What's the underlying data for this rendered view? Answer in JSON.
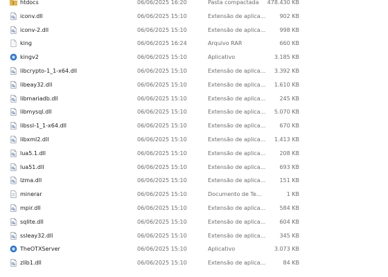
{
  "files": [
    {
      "name": "htdocs",
      "modified": "06/06/2025 16:20",
      "type": "Pasta compactada",
      "size": "478.430 KB",
      "icon": "zip-folder-icon"
    },
    {
      "name": "iconv.dll",
      "modified": "06/06/2025 15:10",
      "type": "Extensão de aplica...",
      "size": "902 KB",
      "icon": "dll-file-icon"
    },
    {
      "name": "iconv-2.dll",
      "modified": "06/06/2025 15:10",
      "type": "Extensão de aplica...",
      "size": "998 KB",
      "icon": "dll-file-icon"
    },
    {
      "name": "king",
      "modified": "06/06/2025 16:24",
      "type": "Arquivo RAR",
      "size": "660 KB",
      "icon": "generic-file-icon"
    },
    {
      "name": "kingv2",
      "modified": "06/06/2025 15:10",
      "type": "Aplicativo",
      "size": "3.185 KB",
      "icon": "app-icon"
    },
    {
      "name": "libcrypto-1_1-x64.dll",
      "modified": "06/06/2025 15:10",
      "type": "Extensão de aplica...",
      "size": "3.392 KB",
      "icon": "dll-file-icon"
    },
    {
      "name": "libeay32.dll",
      "modified": "06/06/2025 15:10",
      "type": "Extensão de aplica...",
      "size": "1.610 KB",
      "icon": "dll-file-icon"
    },
    {
      "name": "libmariadb.dll",
      "modified": "06/06/2025 15:10",
      "type": "Extensão de aplica...",
      "size": "245 KB",
      "icon": "dll-file-icon"
    },
    {
      "name": "libmysql.dll",
      "modified": "06/06/2025 15:10",
      "type": "Extensão de aplica...",
      "size": "5.070 KB",
      "icon": "dll-file-icon"
    },
    {
      "name": "libssl-1_1-x64.dll",
      "modified": "06/06/2025 15:10",
      "type": "Extensão de aplica...",
      "size": "670 KB",
      "icon": "dll-file-icon"
    },
    {
      "name": "libxml2.dll",
      "modified": "06/06/2025 15:10",
      "type": "Extensão de aplica...",
      "size": "1.413 KB",
      "icon": "dll-file-icon"
    },
    {
      "name": "lua5.1.dll",
      "modified": "06/06/2025 15:10",
      "type": "Extensão de aplica...",
      "size": "208 KB",
      "icon": "dll-file-icon"
    },
    {
      "name": "lua51.dll",
      "modified": "06/06/2025 15:10",
      "type": "Extensão de aplica...",
      "size": "693 KB",
      "icon": "dll-file-icon"
    },
    {
      "name": "lzma.dll",
      "modified": "06/06/2025 15:10",
      "type": "Extensão de aplica...",
      "size": "151 KB",
      "icon": "dll-file-icon"
    },
    {
      "name": "minerar",
      "modified": "06/06/2025 15:10",
      "type": "Documento de Te...",
      "size": "1 KB",
      "icon": "text-document-icon"
    },
    {
      "name": "mpir.dll",
      "modified": "06/06/2025 15:10",
      "type": "Extensão de aplica...",
      "size": "584 KB",
      "icon": "dll-file-icon"
    },
    {
      "name": "sqlite.dll",
      "modified": "06/06/2025 15:10",
      "type": "Extensão de aplica...",
      "size": "604 KB",
      "icon": "dll-file-icon"
    },
    {
      "name": "ssleay32.dll",
      "modified": "06/06/2025 15:10",
      "type": "Extensão de aplica...",
      "size": "345 KB",
      "icon": "dll-file-icon"
    },
    {
      "name": "TheOTXServer",
      "modified": "06/06/2025 15:10",
      "type": "Aplicativo",
      "size": "3.073 KB",
      "icon": "app-icon"
    },
    {
      "name": "zlib1.dll",
      "modified": "06/06/2025 15:10",
      "type": "Extensão de aplica...",
      "size": "84 KB",
      "icon": "dll-file-icon"
    }
  ],
  "colors": {
    "name_text": "#1a1a1a",
    "meta_text": "#6d6d6d",
    "folder_yellow": "#e8b84a",
    "app_blue": "#2a6fd1"
  }
}
